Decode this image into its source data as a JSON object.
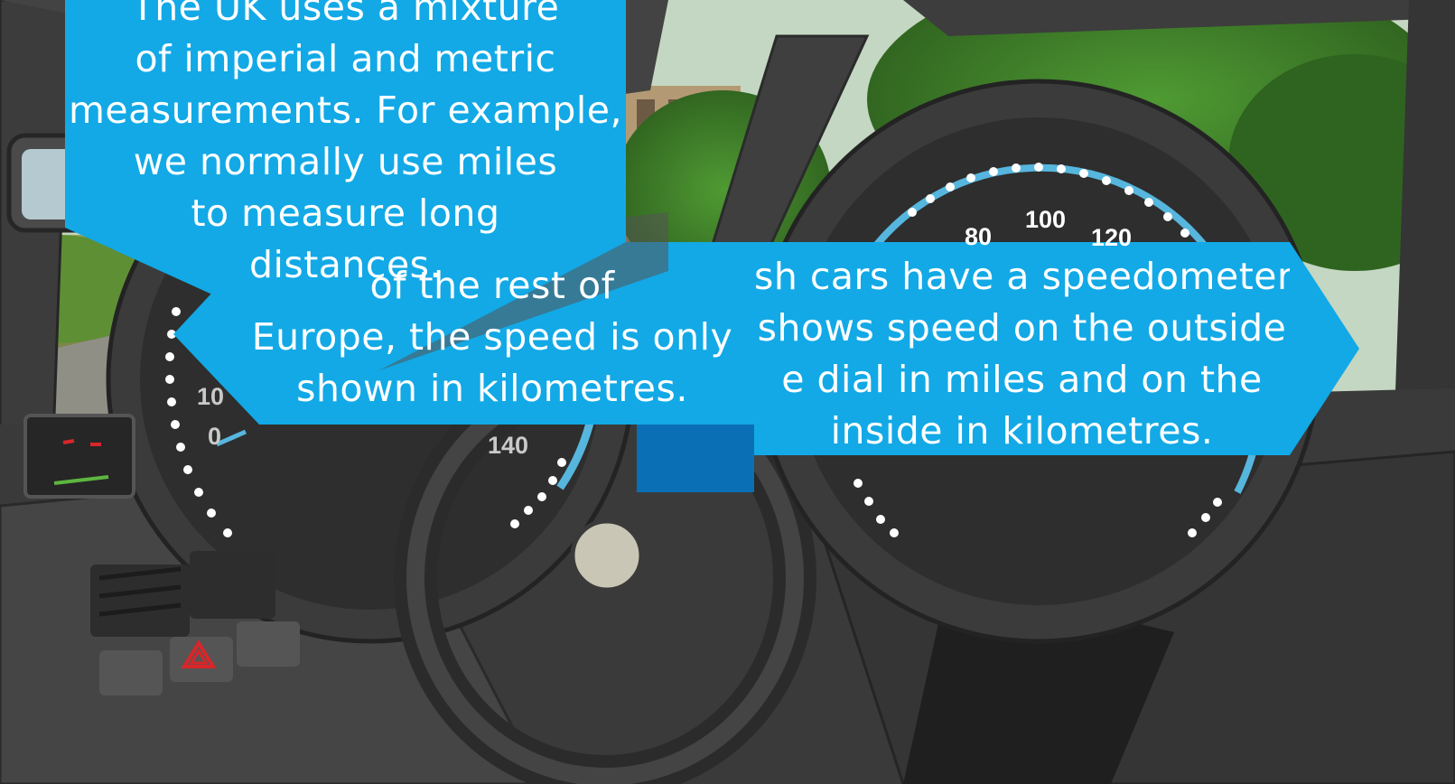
{
  "colors": {
    "callout_blue": "#12a9e6",
    "callout_shadow": "#0b6fb6",
    "dashboard_dark": "#3a3a3a",
    "gauge_face": "#2e2e2e",
    "gauge_ring": "#56b6de",
    "foliage": "#3f7d2a",
    "hazard_red": "#d8262a"
  },
  "callout_uk": {
    "lines": [
      "The UK uses a mixture",
      "of imperial and metric",
      "measurements. For example,",
      "we normally use miles",
      "to measure long",
      "distances."
    ]
  },
  "callout_europe": {
    "lines": [
      "of the rest of",
      "Europe, the speed is only",
      "shown in kilometres."
    ]
  },
  "callout_british": {
    "lines": [
      "sh cars have a speedometer",
      "shows speed on the outside",
      "e dial in miles and on the",
      "inside in kilometres."
    ]
  },
  "left_gauge": {
    "labels": [
      "10",
      "0",
      "140"
    ]
  },
  "right_gauge": {
    "labels": [
      "80",
      "100",
      "120"
    ]
  },
  "icons": [
    "hazard-warning-icon",
    "rear-view-mirror",
    "steering-wheel"
  ]
}
